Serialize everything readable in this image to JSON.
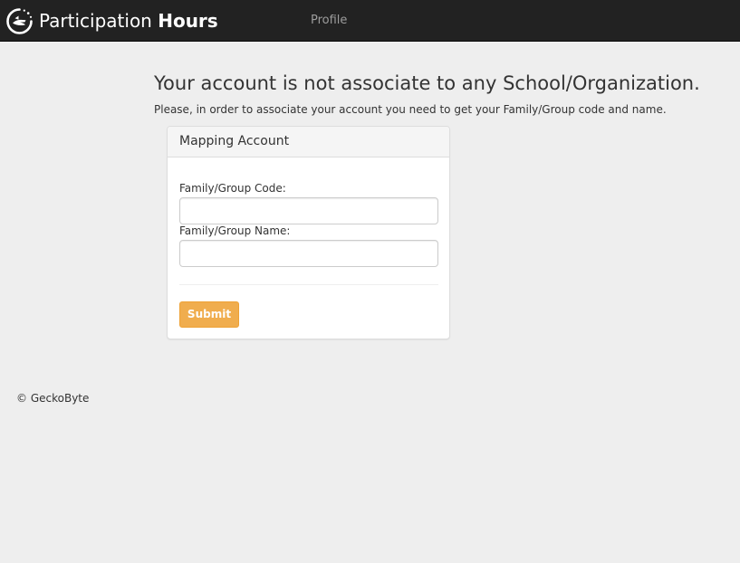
{
  "navbar": {
    "logo_icon": "refresh-hand-icon",
    "brand_light": "Participation",
    "brand_bold": "Hours",
    "links": [
      {
        "label": "Profile"
      }
    ]
  },
  "main": {
    "heading": "Your account is not associate to any School/Organization.",
    "instruction": "Please, in order to associate your account you need to get your Family/Group code and name."
  },
  "panel": {
    "title": "Mapping Account",
    "fields": [
      {
        "label": "Family/Group Code:",
        "value": "",
        "placeholder": ""
      },
      {
        "label": "Family/Group Name:",
        "value": "",
        "placeholder": ""
      }
    ],
    "submit_label": "Submit"
  },
  "footer": {
    "copyright": "© GeckoByte"
  },
  "colors": {
    "navbar_bg": "#222222",
    "page_bg": "#eeeeee",
    "nav_link": "#9d9d9d",
    "submit_bg": "#f0ad4e",
    "submit_border": "#eea236"
  }
}
